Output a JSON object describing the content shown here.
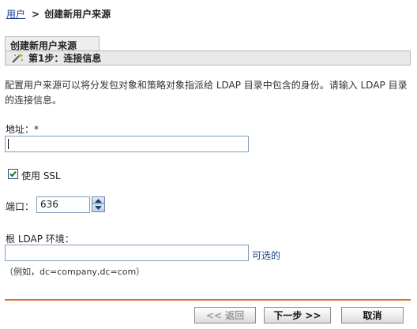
{
  "breadcrumb": {
    "link": "用户",
    "separator": ">",
    "current": "创建新用户来源"
  },
  "section": {
    "title": "创建新用户来源",
    "step": "第1步：连接信息",
    "step_icon": "wand-icon"
  },
  "description": "配置用户来源可以将分发包对象和策略对象指派给 LDAP 目录中包含的身份。请输入 LDAP 目录的连接信息。",
  "form": {
    "address_label": "地址：",
    "address_required": "*",
    "address_value": "",
    "use_ssl_label": "使用 SSL",
    "use_ssl_checked": true,
    "port_label": "端口：",
    "port_value": "636",
    "root_label": "根 LDAP 环境：",
    "root_value": "",
    "root_optional": "可选的",
    "root_hint": "（例如，dc=company,dc=com）"
  },
  "buttons": {
    "back": "<< 返回",
    "next": "下一步 >>",
    "cancel": "取消"
  },
  "colors": {
    "link": "#1a3f8f",
    "footer_rule": "#e06a2a",
    "header_bg": "#e9e9e9"
  }
}
